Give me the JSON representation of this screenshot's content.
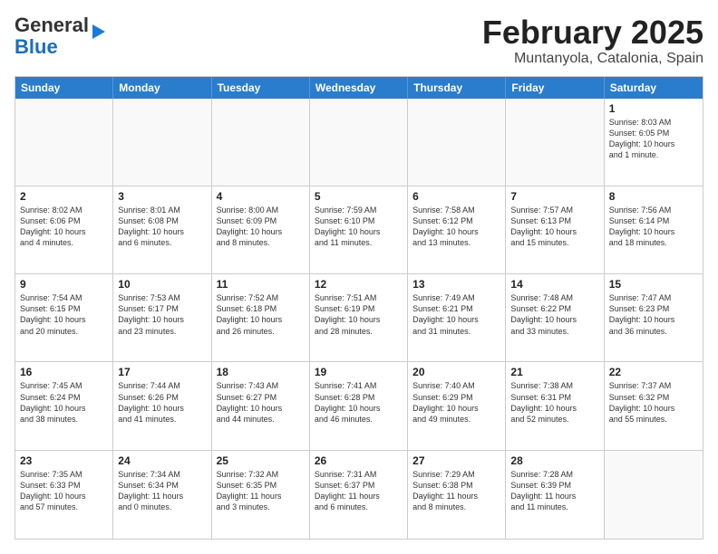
{
  "header": {
    "logo_line1": "General",
    "logo_line2": "Blue",
    "title": "February 2025",
    "subtitle": "Muntanyola, Catalonia, Spain"
  },
  "calendar": {
    "days": [
      "Sunday",
      "Monday",
      "Tuesday",
      "Wednesday",
      "Thursday",
      "Friday",
      "Saturday"
    ],
    "rows": [
      [
        {
          "day": "",
          "info": ""
        },
        {
          "day": "",
          "info": ""
        },
        {
          "day": "",
          "info": ""
        },
        {
          "day": "",
          "info": ""
        },
        {
          "day": "",
          "info": ""
        },
        {
          "day": "",
          "info": ""
        },
        {
          "day": "1",
          "info": "Sunrise: 8:03 AM\nSunset: 6:05 PM\nDaylight: 10 hours\nand 1 minute."
        }
      ],
      [
        {
          "day": "2",
          "info": "Sunrise: 8:02 AM\nSunset: 6:06 PM\nDaylight: 10 hours\nand 4 minutes."
        },
        {
          "day": "3",
          "info": "Sunrise: 8:01 AM\nSunset: 6:08 PM\nDaylight: 10 hours\nand 6 minutes."
        },
        {
          "day": "4",
          "info": "Sunrise: 8:00 AM\nSunset: 6:09 PM\nDaylight: 10 hours\nand 8 minutes."
        },
        {
          "day": "5",
          "info": "Sunrise: 7:59 AM\nSunset: 6:10 PM\nDaylight: 10 hours\nand 11 minutes."
        },
        {
          "day": "6",
          "info": "Sunrise: 7:58 AM\nSunset: 6:12 PM\nDaylight: 10 hours\nand 13 minutes."
        },
        {
          "day": "7",
          "info": "Sunrise: 7:57 AM\nSunset: 6:13 PM\nDaylight: 10 hours\nand 15 minutes."
        },
        {
          "day": "8",
          "info": "Sunrise: 7:56 AM\nSunset: 6:14 PM\nDaylight: 10 hours\nand 18 minutes."
        }
      ],
      [
        {
          "day": "9",
          "info": "Sunrise: 7:54 AM\nSunset: 6:15 PM\nDaylight: 10 hours\nand 20 minutes."
        },
        {
          "day": "10",
          "info": "Sunrise: 7:53 AM\nSunset: 6:17 PM\nDaylight: 10 hours\nand 23 minutes."
        },
        {
          "day": "11",
          "info": "Sunrise: 7:52 AM\nSunset: 6:18 PM\nDaylight: 10 hours\nand 26 minutes."
        },
        {
          "day": "12",
          "info": "Sunrise: 7:51 AM\nSunset: 6:19 PM\nDaylight: 10 hours\nand 28 minutes."
        },
        {
          "day": "13",
          "info": "Sunrise: 7:49 AM\nSunset: 6:21 PM\nDaylight: 10 hours\nand 31 minutes."
        },
        {
          "day": "14",
          "info": "Sunrise: 7:48 AM\nSunset: 6:22 PM\nDaylight: 10 hours\nand 33 minutes."
        },
        {
          "day": "15",
          "info": "Sunrise: 7:47 AM\nSunset: 6:23 PM\nDaylight: 10 hours\nand 36 minutes."
        }
      ],
      [
        {
          "day": "16",
          "info": "Sunrise: 7:45 AM\nSunset: 6:24 PM\nDaylight: 10 hours\nand 38 minutes."
        },
        {
          "day": "17",
          "info": "Sunrise: 7:44 AM\nSunset: 6:26 PM\nDaylight: 10 hours\nand 41 minutes."
        },
        {
          "day": "18",
          "info": "Sunrise: 7:43 AM\nSunset: 6:27 PM\nDaylight: 10 hours\nand 44 minutes."
        },
        {
          "day": "19",
          "info": "Sunrise: 7:41 AM\nSunset: 6:28 PM\nDaylight: 10 hours\nand 46 minutes."
        },
        {
          "day": "20",
          "info": "Sunrise: 7:40 AM\nSunset: 6:29 PM\nDaylight: 10 hours\nand 49 minutes."
        },
        {
          "day": "21",
          "info": "Sunrise: 7:38 AM\nSunset: 6:31 PM\nDaylight: 10 hours\nand 52 minutes."
        },
        {
          "day": "22",
          "info": "Sunrise: 7:37 AM\nSunset: 6:32 PM\nDaylight: 10 hours\nand 55 minutes."
        }
      ],
      [
        {
          "day": "23",
          "info": "Sunrise: 7:35 AM\nSunset: 6:33 PM\nDaylight: 10 hours\nand 57 minutes."
        },
        {
          "day": "24",
          "info": "Sunrise: 7:34 AM\nSunset: 6:34 PM\nDaylight: 11 hours\nand 0 minutes."
        },
        {
          "day": "25",
          "info": "Sunrise: 7:32 AM\nSunset: 6:35 PM\nDaylight: 11 hours\nand 3 minutes."
        },
        {
          "day": "26",
          "info": "Sunrise: 7:31 AM\nSunset: 6:37 PM\nDaylight: 11 hours\nand 6 minutes."
        },
        {
          "day": "27",
          "info": "Sunrise: 7:29 AM\nSunset: 6:38 PM\nDaylight: 11 hours\nand 8 minutes."
        },
        {
          "day": "28",
          "info": "Sunrise: 7:28 AM\nSunset: 6:39 PM\nDaylight: 11 hours\nand 11 minutes."
        },
        {
          "day": "",
          "info": ""
        }
      ]
    ]
  }
}
